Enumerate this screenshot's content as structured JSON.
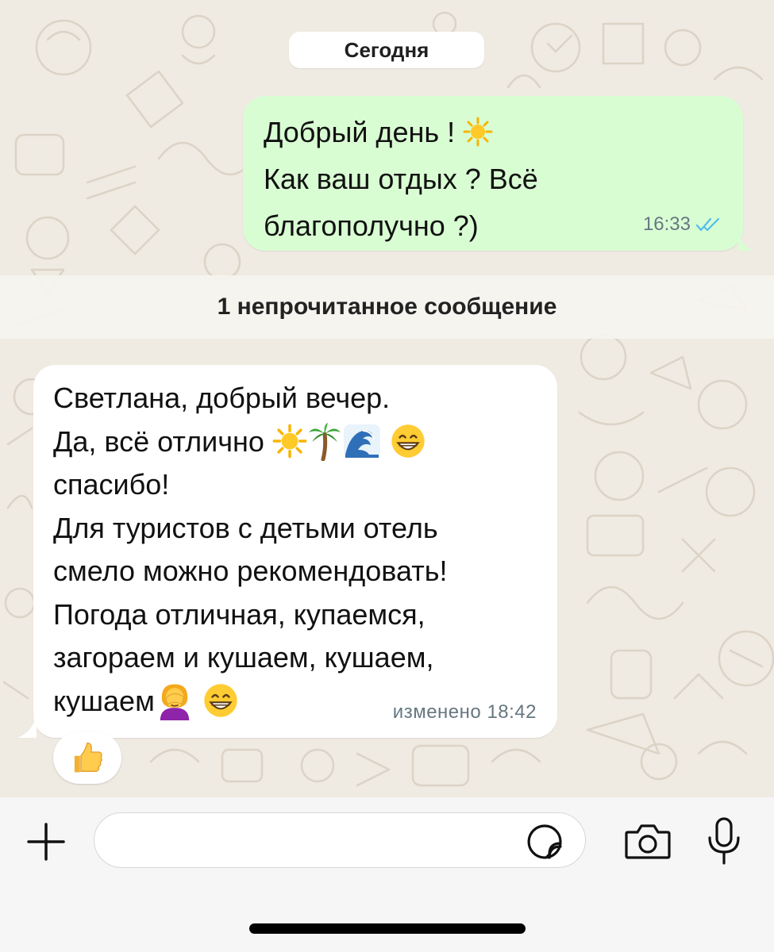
{
  "chat": {
    "date_separator": "Сегодня",
    "unread_separator": "1 непрочитанное сообщение"
  },
  "outgoing": {
    "line1": "Добрый день ! ",
    "line2": "Как ваш отдых ? Всё",
    "line3": "благополучно ?)",
    "time": "16:33",
    "status": "read"
  },
  "incoming": {
    "line1": "Светлана, добрый вечер.",
    "line2": "Да, всё отлично ",
    "line3": "спасибо!",
    "line4": "Для туристов с детьми отель",
    "line5": "смело можно рекомендовать!",
    "line6": "Погода отличная, купаемся,",
    "line7": "загораем и кушаем, кушаем,",
    "line8": "кушаем",
    "edited_label": "изменено",
    "time": "18:42",
    "reaction": "thumbs-up"
  },
  "composer": {
    "placeholder": "",
    "value": ""
  },
  "colors": {
    "background": "#efeae2",
    "outgoing_bubble": "#d9fdd3",
    "incoming_bubble": "#ffffff",
    "read_check": "#53bdeb",
    "meta_text": "#667781"
  }
}
